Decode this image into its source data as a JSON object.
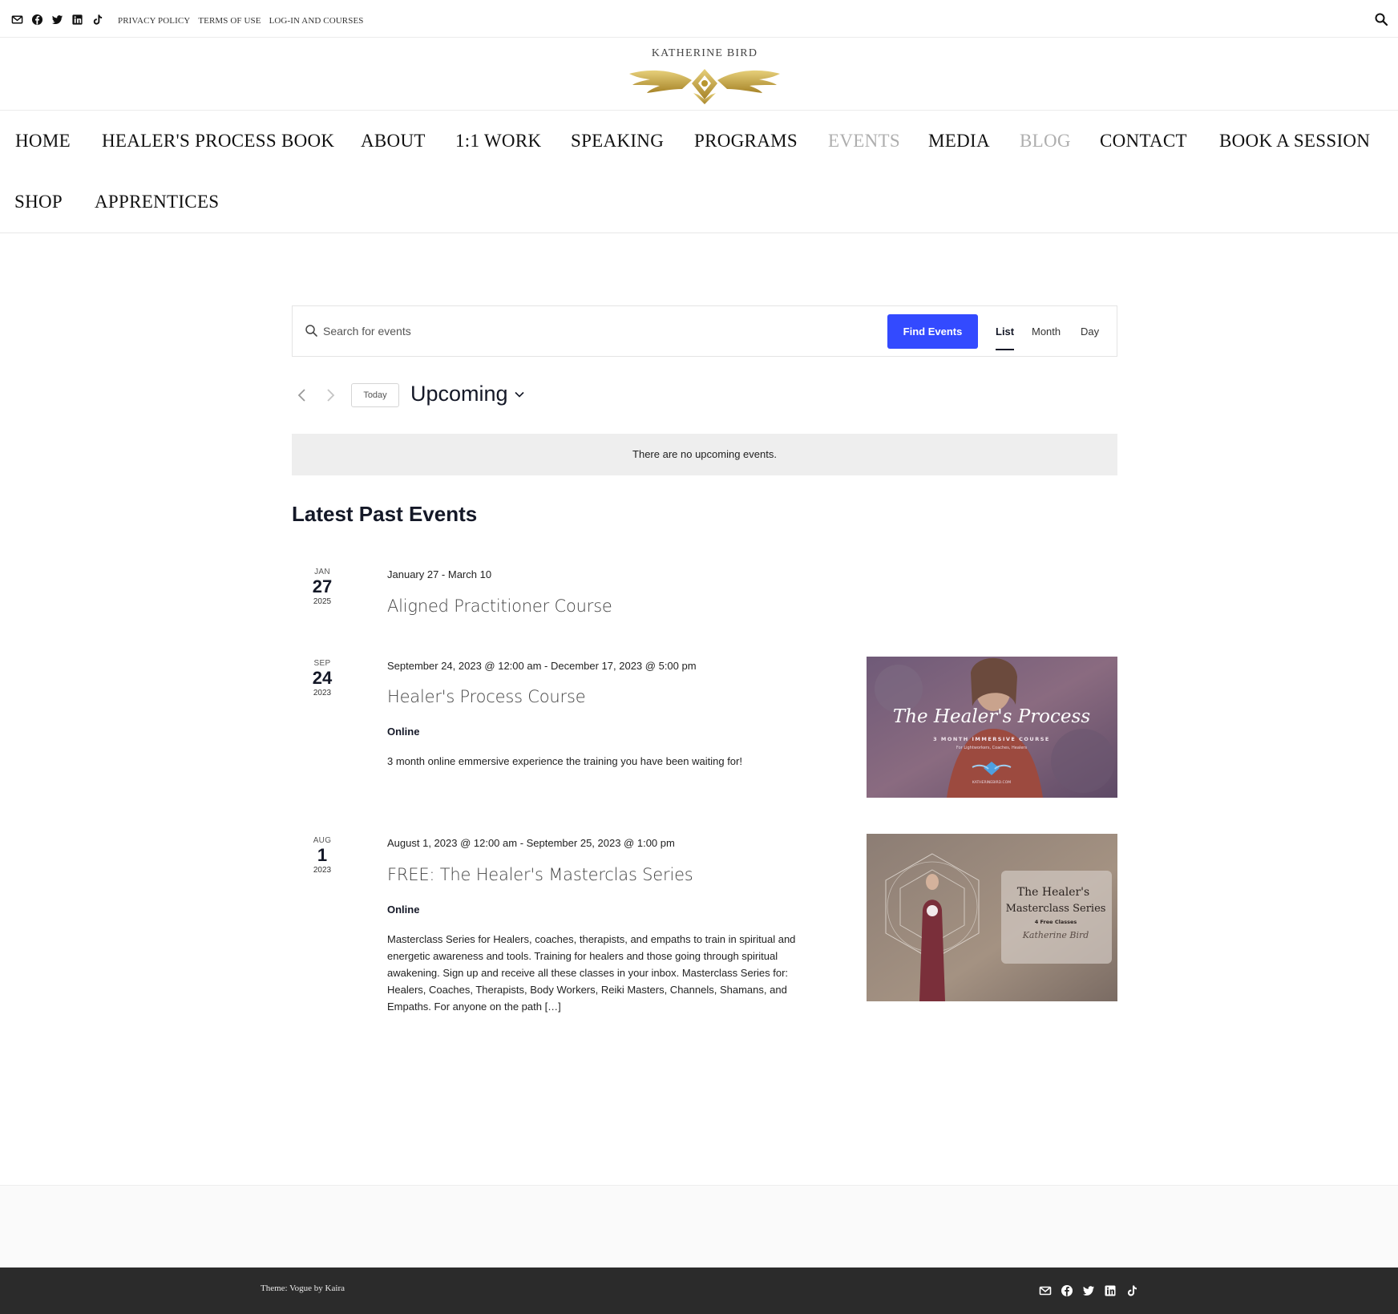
{
  "topbar": {
    "social_icons": [
      "email-icon",
      "facebook-icon",
      "twitter-icon",
      "linkedin-icon",
      "tiktok-icon"
    ],
    "links": [
      "PRIVACY POLICY",
      "TERMS OF USE",
      "LOG-IN AND COURSES"
    ]
  },
  "logo": {
    "text": "KATHERINE BIRD"
  },
  "nav": {
    "items": [
      "HOME",
      "HEALER'S PROCESS BOOK",
      "ABOUT",
      "1:1 WORK",
      "SPEAKING",
      "PROGRAMS",
      "EVENTS",
      "MEDIA",
      "BLOG",
      "CONTACT",
      "BOOK A SESSION",
      "SHOP",
      "APPRENTICES"
    ],
    "active": "EVENTS",
    "muted_color": "#aeaeae"
  },
  "events_bar": {
    "search_placeholder": "Search for events",
    "find_button": "Find Events",
    "views": [
      "List",
      "Month",
      "Day"
    ],
    "active_view": "List",
    "accent": "#334aff"
  },
  "toolbar": {
    "today": "Today",
    "period": "Upcoming"
  },
  "notice": "There are no upcoming events.",
  "past_title": "Latest Past Events",
  "events": [
    {
      "month": "JAN",
      "day": "27",
      "year": "2025",
      "when": "January 27 - March 10",
      "title": "Aligned Practitioner Course"
    },
    {
      "month": "SEP",
      "day": "24",
      "year": "2023",
      "when": "September 24, 2023 @ 12:00 am - December 17, 2023 @ 5:00 pm",
      "title": "Healer's Process Course",
      "venue": "Online",
      "description": "3 month online emmersive experience the training you have been waiting for!",
      "image": {
        "title": "The Healer's Process",
        "subtitle": "3 MONTH IMMERSIVE COURSE",
        "tagline": "For Lightworkers, Coaches, Healers",
        "site": "KATHERINEBIRD.COM"
      }
    },
    {
      "month": "AUG",
      "day": "1",
      "year": "2023",
      "when": "August 1, 2023 @ 12:00 am - September 25, 2023 @ 1:00 pm",
      "title": "FREE: The Healer's Masterclas Series",
      "venue": "Online",
      "description": "Masterclass Series for Healers, coaches, therapists, and empaths to train in spiritual and energetic awareness and tools. Training for healers and those going through spiritual awakening. Sign up and receive all these classes in your inbox.  Masterclass Series for: Healers, Coaches, Therapists, Body Workers, Reiki Masters, Channels, Shamans, and Empaths. For anyone on the path […]",
      "image": {
        "line1": "The Healer's",
        "line2": "Masterclass Series",
        "line3": "4 Free Classes",
        "line4": "Katherine Bird"
      }
    }
  ],
  "footer": {
    "credit": "Theme: Vogue by Kaira",
    "social_icons": [
      "email-icon",
      "facebook-icon",
      "twitter-icon",
      "linkedin-icon",
      "tiktok-icon"
    ]
  }
}
